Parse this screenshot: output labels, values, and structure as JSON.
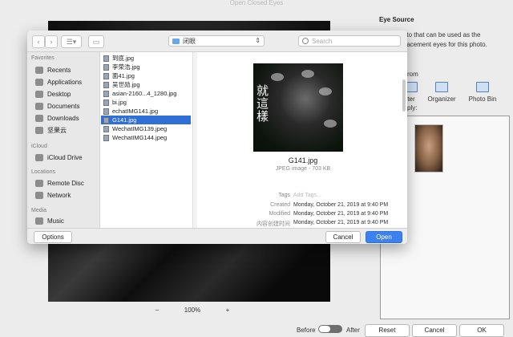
{
  "window": {
    "title": "Open Closed Eyes"
  },
  "canvas": {
    "zoom_out": "−",
    "zoom_level": "100%",
    "zoom_in": "+"
  },
  "right_panel": {
    "title": "Eye Source",
    "desc_line1": "photo that can be used as the",
    "desc_line2": "replacement eyes for this photo.",
    "from_label": "rom",
    "sources": [
      {
        "label": "ter"
      },
      {
        "label": "Organizer"
      },
      {
        "label": "Photo Bin"
      }
    ],
    "apply_label": "ply:"
  },
  "bottom_bar": {
    "before": "Before",
    "after": "After",
    "reset": "Reset",
    "cancel": "Cancel",
    "ok": "OK"
  },
  "dialog": {
    "toolbar": {
      "back": "‹",
      "forward": "›",
      "view": "☰▾",
      "newfolder": "▭",
      "location": "闭眼",
      "search_placeholder": "Search"
    },
    "sidebar": {
      "favorites_label": "Favorites",
      "favorites": [
        "Recents",
        "Applications",
        "Desktop",
        "Documents",
        "Downloads",
        "坚果云"
      ],
      "icloud_label": "iCloud",
      "icloud": [
        "iCloud Drive"
      ],
      "locations_label": "Locations",
      "locations": [
        "Remote Disc",
        "Network"
      ],
      "media_label": "Media",
      "media": [
        "Music"
      ]
    },
    "files": [
      {
        "name": "到底.jpg",
        "selected": false
      },
      {
        "name": "李荣浩.jpg",
        "selected": false
      },
      {
        "name": "面41.jpg",
        "selected": false
      },
      {
        "name": "吴世勋.jpg",
        "selected": false
      },
      {
        "name": "asian-2160...4_1280.jpg",
        "selected": false
      },
      {
        "name": "bi.jpg",
        "selected": false
      },
      {
        "name": "echatIMG141.jpg",
        "selected": false
      },
      {
        "name": "G141.jpg",
        "selected": true
      },
      {
        "name": "WechatIMG139.jpeg",
        "selected": false
      },
      {
        "name": "WechatIMG144.jpeg",
        "selected": false
      }
    ],
    "preview": {
      "image_text": "就\n這\n樣",
      "filename": "G141.jpg",
      "info": "JPEG image - 703 KB",
      "meta": [
        {
          "key": "Tags",
          "value": "Add Tags...",
          "placeholder": true
        },
        {
          "key": "Created",
          "value": "Monday, October 21, 2019 at 9:40 PM",
          "placeholder": false
        },
        {
          "key": "Modified",
          "value": "Monday, October 21, 2019 at 9:40 PM",
          "placeholder": false
        },
        {
          "key": "内容创建时间",
          "value": "Monday, October 21, 2019 at 9:40 PM",
          "placeholder": false
        }
      ]
    },
    "footer": {
      "options": "Options",
      "cancel": "Cancel",
      "open": "Open"
    }
  }
}
